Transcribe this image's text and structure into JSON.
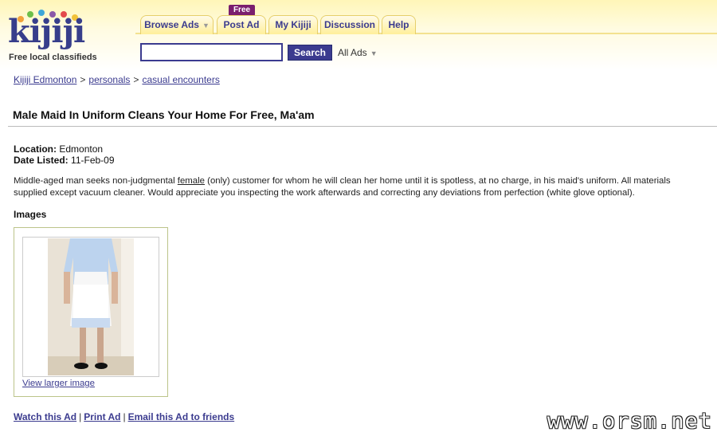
{
  "header": {
    "logo_text": "kijiji",
    "tagline": "Free local classifieds",
    "tabs": [
      {
        "label": "Browse Ads",
        "has_dropdown": true
      },
      {
        "label": "Post Ad",
        "badge": "Free"
      },
      {
        "label": "My Kijiji"
      },
      {
        "label": "Discussion"
      },
      {
        "label": "Help"
      }
    ],
    "search": {
      "value": "",
      "placeholder": "",
      "button_label": "Search",
      "category": "All Ads"
    },
    "colors": {
      "brand": "#3b3b8f",
      "header_bg": "#fff6b8",
      "badge": "#7a1e6e"
    }
  },
  "breadcrumb": [
    {
      "label": "Kijiji Edmonton"
    },
    {
      "label": "personals"
    },
    {
      "label": "casual encounters"
    }
  ],
  "breadcrumb_separator": ">",
  "ad": {
    "title": "Male Maid In Uniform Cleans Your Home For Free, Ma'am",
    "location_label": "Location:",
    "location": "Edmonton",
    "date_label": "Date Listed:",
    "date": "11-Feb-09",
    "description_before": "Middle-aged man seeks non-judgmental ",
    "description_emphasis": "female",
    "description_after": " (only) customer for whom he will clean her home until it is spotless, at no charge, in his maid's uniform.  All materials supplied except vacuum cleaner.  Would appreciate you inspecting the work afterwards and correcting any deviations from perfection (white glove optional).",
    "images_heading": "Images",
    "view_larger_label": "View larger image"
  },
  "actions": [
    {
      "label": "Watch this Ad"
    },
    {
      "label": "Print Ad"
    },
    {
      "label": "Email this Ad to friends"
    }
  ],
  "watermark": "www.orsm.net"
}
